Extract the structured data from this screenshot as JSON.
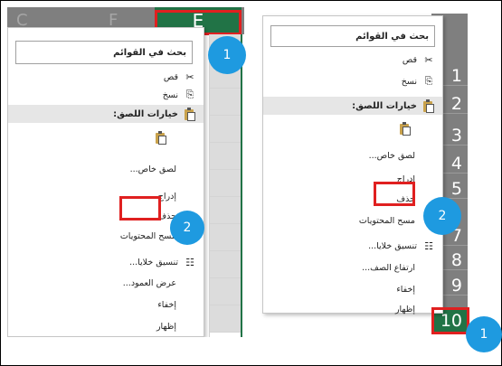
{
  "left": {
    "column_ghost_1": "C",
    "column_ghost_2": "F",
    "column_letter": "E",
    "search_label": "بحث في القوائم",
    "items": {
      "cut": "قص",
      "copy": "نسخ",
      "paste_options": "خيارات اللصق:",
      "paste_special": "لصق خاص...",
      "insert": "إدراج",
      "delete": "حذف",
      "clear_contents": "مسح المحتويات",
      "format_cells": "تنسيق خلايا...",
      "column_width": "عرض العمود...",
      "hide": "إخفاء",
      "unhide": "إظهار"
    },
    "badge_1": "1",
    "badge_2": "2"
  },
  "right": {
    "search_label": "بحث في القوائم",
    "row_numbers": [
      "1",
      "2",
      "3",
      "4",
      "5",
      "6",
      "7",
      "8",
      "9",
      "10"
    ],
    "active_row": "10",
    "items": {
      "cut": "قص",
      "copy": "نسخ",
      "paste_options": "خيارات اللصق:",
      "paste_special": "لصق خاص...",
      "insert": "إدراج",
      "delete": "حذف",
      "clear_contents": "مسح المحتويات",
      "format_cells": "تنسيق خلايا...",
      "row_height": "ارتفاع الصف...",
      "hide": "إخفاء",
      "unhide": "إظهار"
    },
    "badge_1": "1",
    "badge_2": "2"
  },
  "colors": {
    "excel_green": "#217346",
    "header_gray": "#7f7f7f",
    "highlight_red": "#e02020",
    "badge_blue": "#1e9ae0"
  },
  "icons": [
    "scissors-icon",
    "copy-icon",
    "clipboard-icon",
    "format-cells-icon"
  ]
}
